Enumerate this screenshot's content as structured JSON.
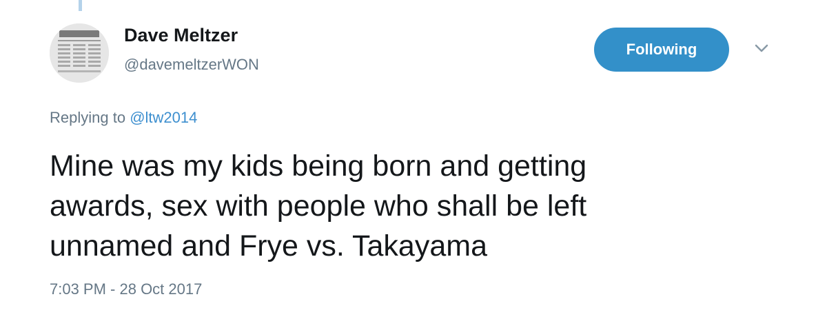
{
  "tweet": {
    "author": {
      "display_name": "Dave Meltzer",
      "handle": "@davemeltzerWON",
      "avatar_icon": "newsletter-avatar-icon"
    },
    "follow_button_label": "Following",
    "menu_icon": "chevron-down-icon",
    "replying_prefix": "Replying to",
    "replying_to": "@ltw2014",
    "text_lines": [
      "Mine was my kids being born and getting",
      "awards, sex with people who shall be left",
      "unnamed and Frye vs. Takayama"
    ],
    "timestamp": "7:03 PM - 28 Oct 2017"
  },
  "colors": {
    "follow_button": "#3390c9",
    "link": "#3d8fcf",
    "secondary_text": "#657786",
    "primary_text": "#14171a",
    "thread_line": "#b4d2ea"
  }
}
